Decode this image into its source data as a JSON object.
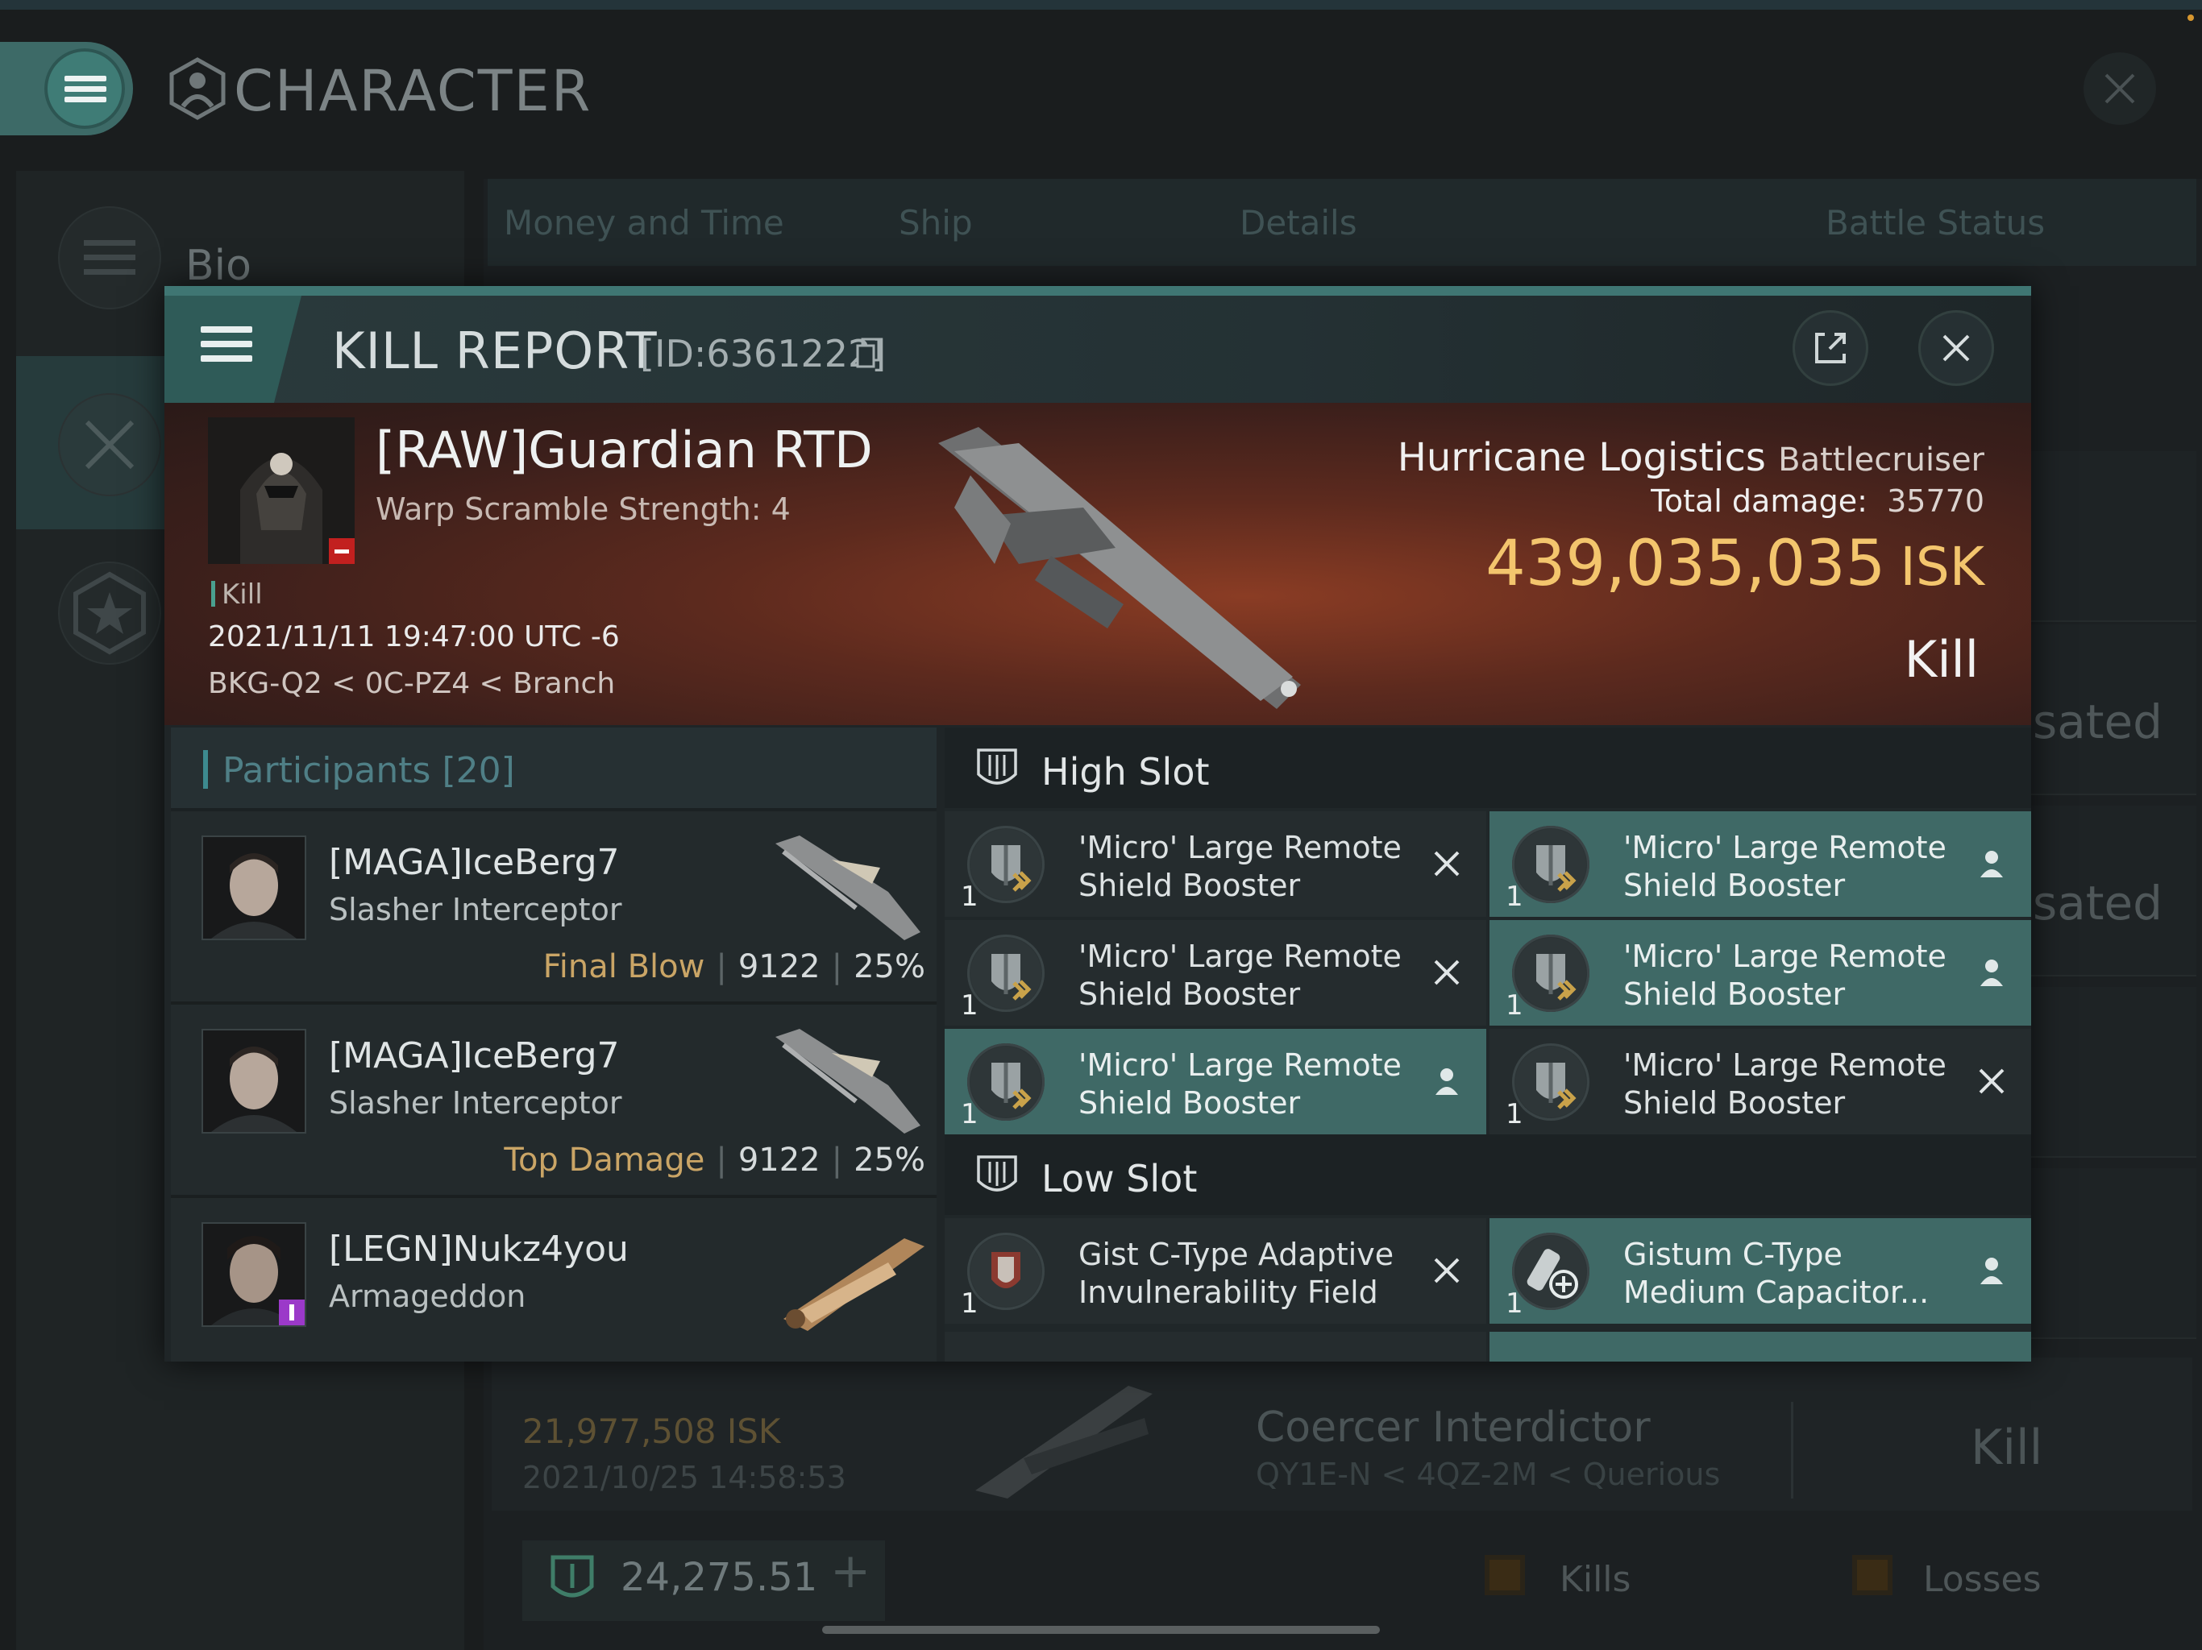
{
  "background": {
    "title": "CHARACTER",
    "sidebar": {
      "bio_label": "Bio"
    },
    "tabs": [
      "Money and Time",
      "Ship",
      "Details",
      "Battle Status"
    ],
    "row_fragments": [
      "sated",
      "sated"
    ],
    "history_row": {
      "isk": "21,977,508",
      "isk_unit": "ISK",
      "date": "2021/10/25  14:58:53",
      "ship": "Coercer Interdictor",
      "location": "QY1E-N < 4QZ-2M < Querious",
      "result": "Kill"
    },
    "wallet": {
      "value": "24,275.51"
    },
    "legend": {
      "kills": "Kills",
      "losses": "Losses"
    }
  },
  "kill_report": {
    "title": "KILL REPORT",
    "id": "[ID:6361222]",
    "victim": {
      "name": "[RAW]Guardian RTD",
      "warp_scramble": "Warp Scramble Strength: 4",
      "tag": "Kill",
      "date": "2021/11/11 19:47:00 UTC -6",
      "location": "BKG-Q2 < 0C-PZ4 < Branch"
    },
    "ship": {
      "name": "Hurricane Logistics",
      "class": "Battlecruiser",
      "total_damage_label": "Total damage:",
      "total_damage": "35770",
      "isk_value": "439,035,035",
      "isk_unit": "ISK",
      "result": "Kill"
    },
    "participants": {
      "label": "Participants",
      "count": "[20]",
      "rows": [
        {
          "name": "[MAGA]IceBerg7",
          "ship": "Slasher Interceptor",
          "tag": "Final Blow",
          "damage": "9122",
          "percent": "25%"
        },
        {
          "name": "[MAGA]IceBerg7",
          "ship": "Slasher Interceptor",
          "tag": "Top Damage",
          "damage": "9122",
          "percent": "25%"
        },
        {
          "name": "[LEGN]Nukz4you",
          "ship": "Armageddon",
          "tag": "",
          "damage": "",
          "percent": ""
        }
      ]
    },
    "fitting": {
      "high_slot_label": "High Slot",
      "low_slot_label": "Low Slot",
      "high_modules": [
        {
          "name": "'Micro' Large Remote Shield Booster",
          "qty": "1",
          "status": "destroyed"
        },
        {
          "name": "'Micro' Large Remote Shield Booster",
          "qty": "1",
          "status": "dropped"
        },
        {
          "name": "'Micro' Large Remote Shield Booster",
          "qty": "1",
          "status": "destroyed"
        },
        {
          "name": "'Micro' Large Remote Shield Booster",
          "qty": "1",
          "status": "dropped"
        },
        {
          "name": "'Micro' Large Remote Shield Booster",
          "qty": "1",
          "status": "dropped"
        },
        {
          "name": "'Micro' Large Remote Shield Booster",
          "qty": "1",
          "status": "destroyed"
        }
      ],
      "low_modules": [
        {
          "name": "Gist C-Type Adaptive Invulnerability Field",
          "qty": "1",
          "status": "destroyed"
        },
        {
          "name": "Gistum C-Type Medium Capacitor...",
          "qty": "1",
          "status": "dropped"
        }
      ]
    }
  },
  "colors": {
    "accent": "#3f6966",
    "isk_gold": "#f3c56d",
    "final_blow": "#caa566"
  }
}
